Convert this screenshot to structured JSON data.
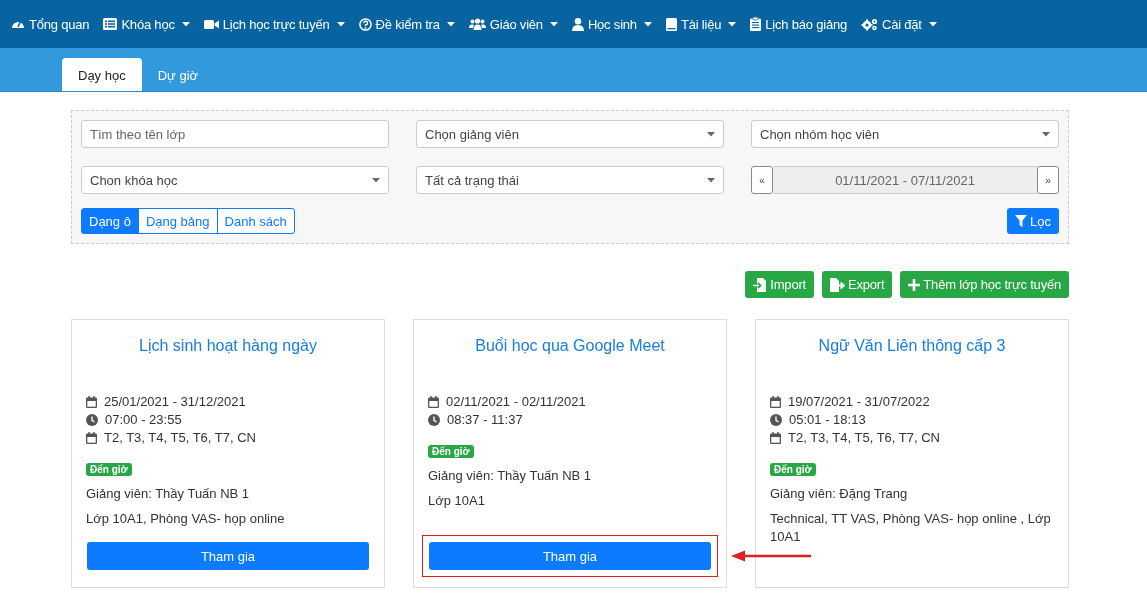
{
  "nav": {
    "items": [
      {
        "label": "Tổng quan",
        "has_menu": false
      },
      {
        "label": "Khóa học",
        "has_menu": true
      },
      {
        "label": "Lịch học trực tuyến",
        "has_menu": true
      },
      {
        "label": "Đề kiểm tra",
        "has_menu": true
      },
      {
        "label": "Giáo viên",
        "has_menu": true
      },
      {
        "label": "Học sinh",
        "has_menu": true
      },
      {
        "label": "Tài liệu",
        "has_menu": true
      },
      {
        "label": "Lịch báo giảng",
        "has_menu": false
      },
      {
        "label": "Cài đặt",
        "has_menu": true
      }
    ]
  },
  "tabs": [
    {
      "label": "Dạy học",
      "selected": true
    },
    {
      "label": "Dự giờ",
      "selected": false
    }
  ],
  "filters": {
    "search": {
      "placeholder": "Tìm theo tên lớp"
    },
    "selects": [
      {
        "value": "Chọn giảng viên"
      },
      {
        "value": "Chọn nhóm học viên"
      },
      {
        "value": "Chon khóa học"
      },
      {
        "value": "Tất cả trạng thái"
      }
    ],
    "date_range": {
      "prev": "«",
      "range": "01/11/2021 - 07/11/2021",
      "next": "»"
    },
    "views": [
      {
        "label": "Dạng ô",
        "selected": true
      },
      {
        "label": "Dạng bảng",
        "selected": false
      },
      {
        "label": "Danh sách",
        "selected": false
      }
    ],
    "filter_button": "Lọc"
  },
  "actions": [
    {
      "label": "Import"
    },
    {
      "label": "Export"
    },
    {
      "label": "Thêm lớp học trực tuyến"
    }
  ],
  "cards": [
    {
      "title": "Lịch sinh hoạt hàng ngày",
      "info": [
        {
          "kind": "date",
          "text": "25/01/2021 - 31/12/2021"
        },
        {
          "kind": "time",
          "text": "07:00 - 23:55"
        },
        {
          "kind": "days",
          "text": "T2, T3, T4, T5, T6, T7, CN"
        }
      ],
      "status": "Đến giờ",
      "teacher": "Giảng viên: Thầy Tuấn NB 1",
      "location": "Lớp 10A1, Phòng VAS- họp online",
      "button": "Tham gia",
      "highlighted": false
    },
    {
      "title": "Buổi học qua Google Meet",
      "info": [
        {
          "kind": "date",
          "text": "02/11/2021 - 02/11/2021"
        },
        {
          "kind": "time",
          "text": "08:37 - 11:37"
        }
      ],
      "status": "Đến giờ",
      "teacher": "Giảng viên: Thầy Tuấn NB 1",
      "location": "Lớp 10A1",
      "button": "Tham gia",
      "highlighted": true
    },
    {
      "title": "Ngữ Văn Liên thông cấp 3",
      "info": [
        {
          "kind": "date",
          "text": "19/07/2021 - 31/07/2022"
        },
        {
          "kind": "time",
          "text": "05:01 - 18:13"
        },
        {
          "kind": "days",
          "text": "T2, T3, T4, T5, T6, T7, CN"
        }
      ],
      "status": "Đến giờ",
      "teacher": "Giảng viên: Đặng Trang",
      "location": "Technical, TT VAS, Phòng VAS- họp online , Lớp 10A1",
      "highlighted": false
    }
  ]
}
